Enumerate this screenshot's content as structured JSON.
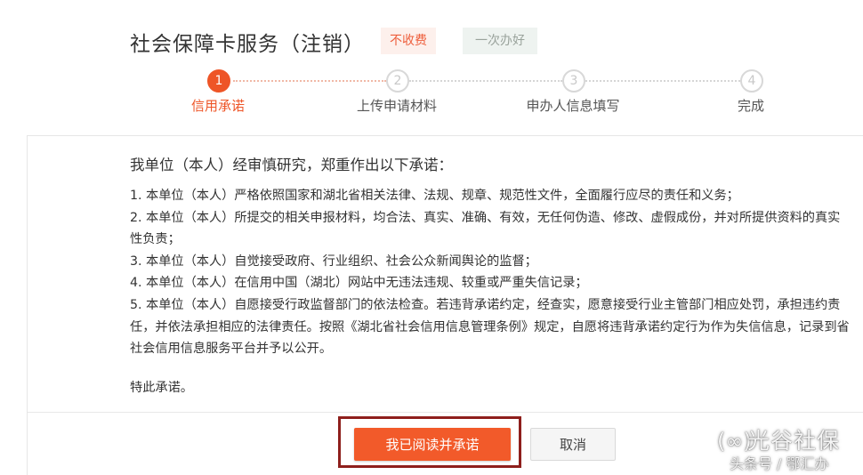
{
  "header": {
    "title": "社会保障卡服务（注销）",
    "tags": [
      "不收费",
      "一次办好"
    ]
  },
  "steps": [
    {
      "number": "1",
      "label": "信用承诺",
      "active": true
    },
    {
      "number": "2",
      "label": "上传申请材料",
      "active": false
    },
    {
      "number": "3",
      "label": "申办人信息填写",
      "active": false
    },
    {
      "number": "4",
      "label": "完成",
      "active": false
    }
  ],
  "commitment": {
    "lead": "我单位（本人）经审慎研究，郑重作出以下承诺：",
    "items": [
      "1. 本单位（本人）严格依照国家和湖北省相关法律、法规、规章、规范性文件，全面履行应尽的责任和义务；",
      "2. 本单位（本人）所提交的相关申报材料，均合法、真实、准确、有效，无任何伪造、修改、虚假成份，并对所提供资料的真实性负责；",
      "3. 本单位（本人）自觉接受政府、行业组织、社会公众新闻舆论的监督；",
      "4. 本单位（本人）在信用中国（湖北）网站中无违法违规、较重或严重失信记录；",
      "5. 本单位（本人）自愿接受行政监督部门的依法检查。若违背承诺约定，经查实，愿意接受行业主管部门相应处罚，承担违约责任，并依法承担相应的法律责任。按照《湖北省社会信用信息管理条例》规定，自愿将违背承诺约定行为作为失信信息，记录到省社会信用信息服务平台并予以公开。"
    ],
    "closing": "特此承诺。"
  },
  "actions": {
    "confirm_label": "我已阅读并承诺",
    "cancel_label": "取消"
  },
  "watermark": {
    "logo": "(∞)",
    "main": "光谷社保",
    "sub": "头条号 / 鄂汇办"
  },
  "colors": {
    "accent": "#f25a2a",
    "highlight_border": "#8e1f1c"
  }
}
